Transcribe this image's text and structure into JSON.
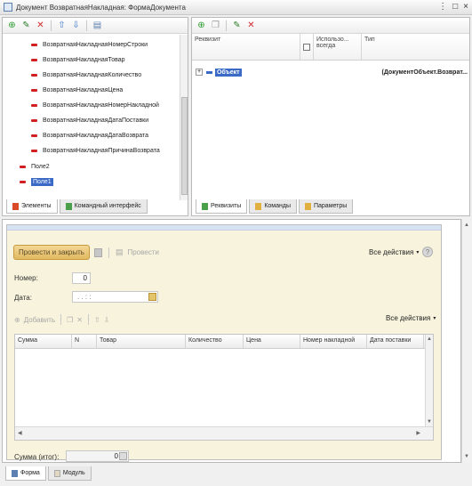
{
  "window": {
    "title": "Документ ВозвратнаяНакладная: ФормаДокумента"
  },
  "elements_panel": {
    "items": [
      {
        "label": "ВозвратнаяНакладнаяНомерСтроки",
        "indent": 2
      },
      {
        "label": "ВозвратнаяНакладнаяТовар",
        "indent": 2
      },
      {
        "label": "ВозвратнаяНакладнаяКоличество",
        "indent": 2
      },
      {
        "label": "ВозвратнаяНакладнаяЦена",
        "indent": 2
      },
      {
        "label": "ВозвратнаяНакладнаяНомерНакладной",
        "indent": 2
      },
      {
        "label": "ВозвратнаяНакладнаяДатаПоставки",
        "indent": 2
      },
      {
        "label": "ВозвратнаяНакладнаяДатаВозврата",
        "indent": 2
      },
      {
        "label": "ВозвратнаяНакладнаяПричинаВозврата",
        "indent": 2
      },
      {
        "label": "Поле2",
        "indent": 1
      },
      {
        "label": "Поле1",
        "indent": 1,
        "selected": true
      }
    ],
    "tabs": [
      "Элементы",
      "Командный интерфейс"
    ]
  },
  "attributes_panel": {
    "columns": {
      "rekvizit": "Реквизит",
      "always_use": "Использо... всегда",
      "type": "Тип"
    },
    "rows": [
      {
        "name": "Объект",
        "type": "(ДокументОбъект.Возврат..."
      }
    ],
    "tabs": [
      "Реквизиты",
      "Команды",
      "Параметры"
    ]
  },
  "form_preview": {
    "post_and_close": "Провести и закрыть",
    "post": "Провести",
    "all_actions": "Все действия",
    "help": "?",
    "number_label": "Номер:",
    "number_value": "0",
    "date_label": "Дата:",
    "date_value": ". .   : :",
    "add": "Добавить",
    "table_all_actions": "Все действия",
    "columns": [
      "Сумма",
      "N",
      "Товар",
      "Количество",
      "Цена",
      "Номер накладной",
      "Дата поставки"
    ],
    "total_label": "Сумма (итог):",
    "total_value": "0"
  },
  "bottom_tabs": [
    "Форма",
    "Модуль"
  ]
}
